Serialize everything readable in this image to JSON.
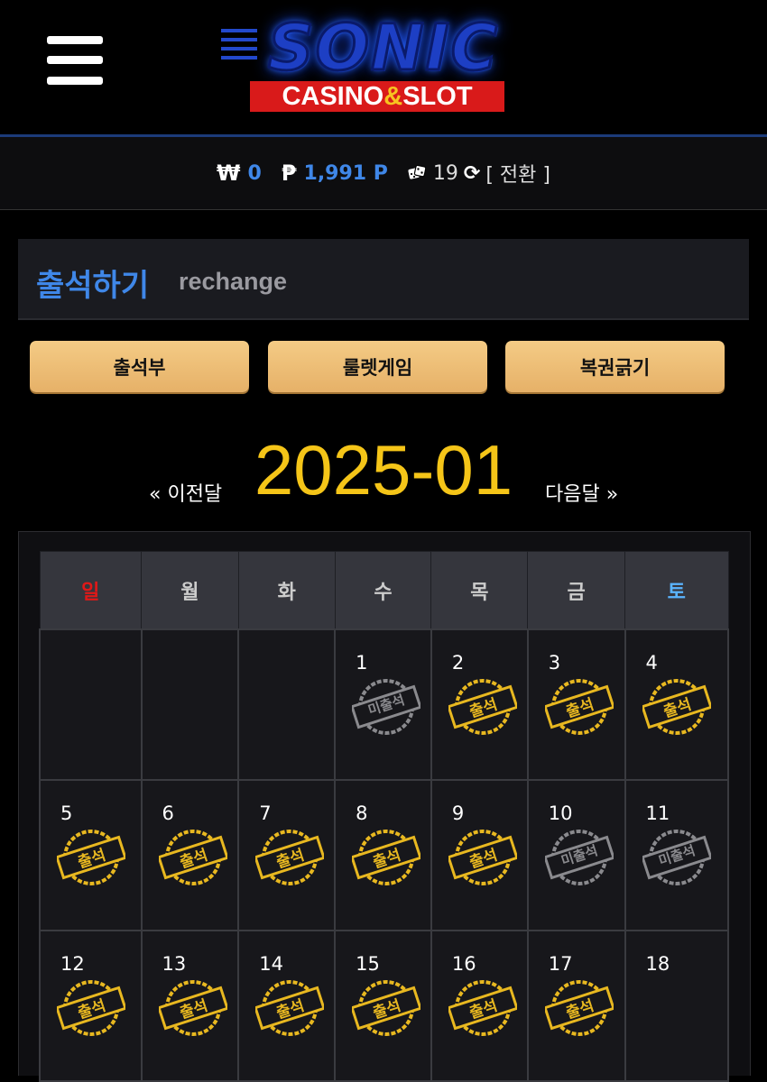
{
  "header": {
    "logo_main": "SONIC",
    "logo_sub_left": "CASINO",
    "logo_sub_amp": "&",
    "logo_sub_right": "SLOT"
  },
  "balance": {
    "won_symbol": "₩",
    "won_value": "0",
    "point_symbol": "₱",
    "point_value": "1,991 P",
    "dice_count": "19",
    "refresh_symbol": "⟳",
    "convert_label": "[ 전환 ]"
  },
  "section": {
    "title_ko": "출석하기",
    "title_en": "rechange"
  },
  "buttons": {
    "attendance": "출석부",
    "roulette": "룰렛게임",
    "lottery": "복권긁기"
  },
  "month_nav": {
    "prev": "« 이전달",
    "current": "2025-01",
    "next": "다음달 »"
  },
  "calendar": {
    "weekdays": [
      "일",
      "월",
      "화",
      "수",
      "목",
      "금",
      "토"
    ],
    "weeks": [
      [
        null,
        null,
        null,
        {
          "day": "1",
          "stamp": "미출석",
          "attended": false
        },
        {
          "day": "2",
          "stamp": "출석",
          "attended": true
        },
        {
          "day": "3",
          "stamp": "출석",
          "attended": true
        },
        {
          "day": "4",
          "stamp": "출석",
          "attended": true
        }
      ],
      [
        {
          "day": "5",
          "stamp": "출석",
          "attended": true
        },
        {
          "day": "6",
          "stamp": "출석",
          "attended": true
        },
        {
          "day": "7",
          "stamp": "출석",
          "attended": true
        },
        {
          "day": "8",
          "stamp": "출석",
          "attended": true
        },
        {
          "day": "9",
          "stamp": "출석",
          "attended": true
        },
        {
          "day": "10",
          "stamp": "미출석",
          "attended": false
        },
        {
          "day": "11",
          "stamp": "미출석",
          "attended": false
        }
      ],
      [
        {
          "day": "12",
          "stamp": "출석",
          "attended": true
        },
        {
          "day": "13",
          "stamp": "출석",
          "attended": true
        },
        {
          "day": "14",
          "stamp": "출석",
          "attended": true
        },
        {
          "day": "15",
          "stamp": "출석",
          "attended": true
        },
        {
          "day": "16",
          "stamp": "출석",
          "attended": true
        },
        {
          "day": "17",
          "stamp": "출석",
          "attended": true
        },
        {
          "day": "18",
          "stamp": null,
          "attended": null
        }
      ]
    ]
  },
  "colors": {
    "accent_blue": "#3f87e8",
    "gold": "#f5c518",
    "stamp_gold": "#e8b820",
    "stamp_gray": "#8a8a8e",
    "sunday_red": "#e01818",
    "saturday_blue": "#5ab4ff"
  }
}
